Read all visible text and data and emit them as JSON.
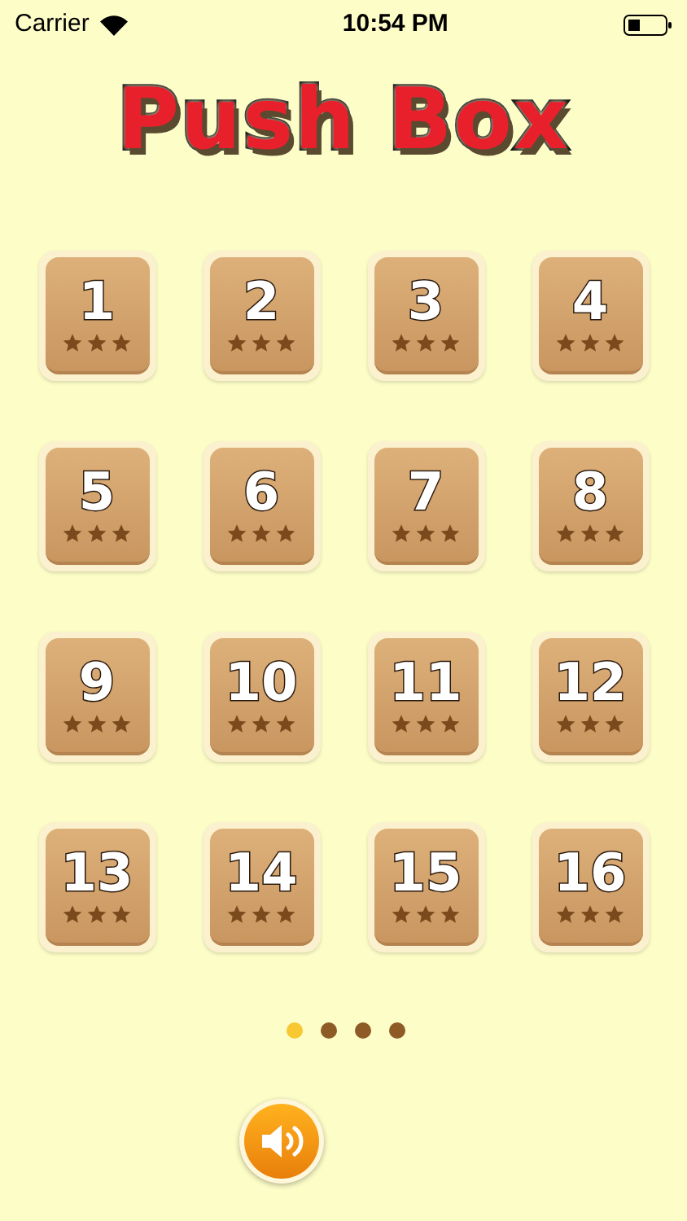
{
  "status_bar": {
    "carrier": "Carrier",
    "time": "10:54 PM"
  },
  "title": "Push Box",
  "levels": [
    {
      "number": "1",
      "stars": 3
    },
    {
      "number": "2",
      "stars": 3
    },
    {
      "number": "3",
      "stars": 3
    },
    {
      "number": "4",
      "stars": 3
    },
    {
      "number": "5",
      "stars": 3
    },
    {
      "number": "6",
      "stars": 3
    },
    {
      "number": "7",
      "stars": 3
    },
    {
      "number": "8",
      "stars": 3
    },
    {
      "number": "9",
      "stars": 3
    },
    {
      "number": "10",
      "stars": 3
    },
    {
      "number": "11",
      "stars": 3
    },
    {
      "number": "12",
      "stars": 3
    },
    {
      "number": "13",
      "stars": 3
    },
    {
      "number": "14",
      "stars": 3
    },
    {
      "number": "15",
      "stars": 3
    },
    {
      "number": "16",
      "stars": 3
    }
  ],
  "pages": [
    {
      "selected": true
    },
    {
      "selected": false
    },
    {
      "selected": false
    },
    {
      "selected": false
    }
  ],
  "sound": {
    "on": true
  }
}
